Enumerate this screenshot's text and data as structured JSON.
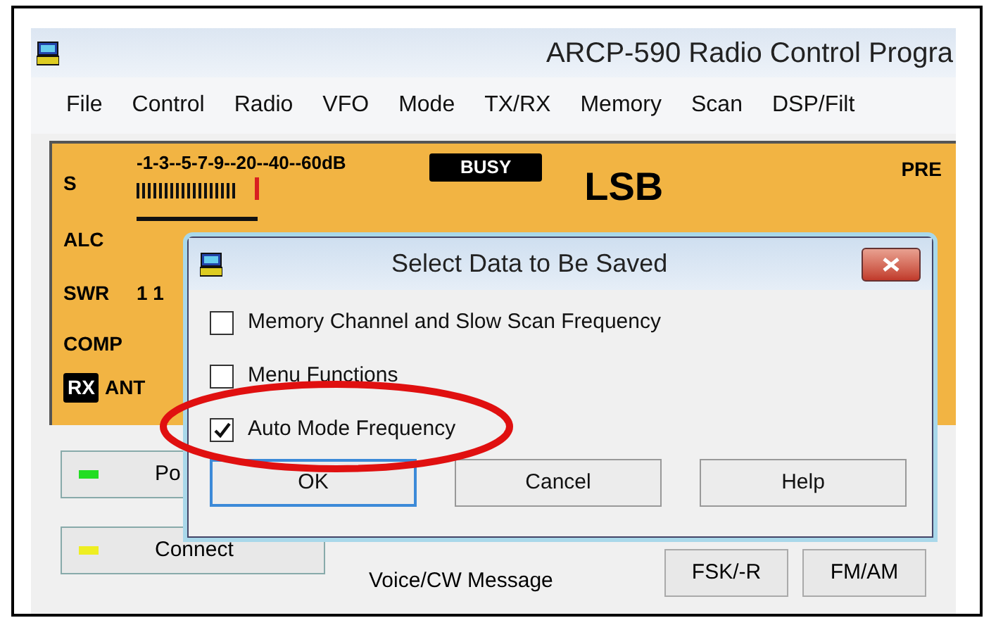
{
  "window": {
    "title": "ARCP-590 Radio Control Progra"
  },
  "menu": [
    "File",
    "Control",
    "Radio",
    "VFO",
    "Mode",
    "TX/RX",
    "Memory",
    "Scan",
    "DSP/Filt"
  ],
  "meter_panel": {
    "s_label": "S",
    "scale": "-1-3--5-7-9--20--40--60dB",
    "busy": "BUSY",
    "mode": "LSB",
    "pre": "PRE",
    "alc_label": "ALC",
    "swr_label": "SWR",
    "swr_values": "1 1",
    "comp_label": "COMP",
    "rx": "RX",
    "ant": "ANT"
  },
  "buttons": [
    {
      "label": "Po",
      "color": "#22dd22"
    },
    {
      "label": "Connect",
      "color": "#eeee22"
    }
  ],
  "group_label": "Voice/CW Message",
  "mode_buttons": [
    "FSK/-R",
    "FM/AM"
  ],
  "dialog": {
    "title": "Select Data to Be Saved",
    "options": [
      {
        "label": "Memory Channel and Slow Scan Frequency",
        "checked": false
      },
      {
        "label": "Menu Functions",
        "checked": false
      },
      {
        "label": "Auto Mode Frequency",
        "checked": true
      }
    ],
    "buttons": [
      {
        "label": "OK",
        "default": true
      },
      {
        "label": "Cancel",
        "default": false
      },
      {
        "label": "Help",
        "default": false
      }
    ]
  }
}
